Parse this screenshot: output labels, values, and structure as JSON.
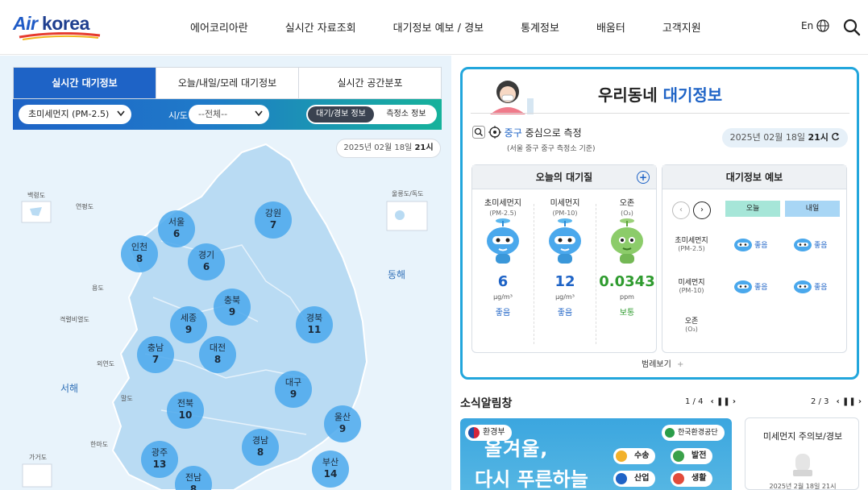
{
  "header": {
    "logo_air": "Air",
    "logo_korea": "korea",
    "nav": [
      "에어코리아란",
      "실시간 자료조회",
      "대기정보 예보 / 경보",
      "통계정보",
      "배움터",
      "고객지원"
    ],
    "lang": "En"
  },
  "left": {
    "tabs": [
      "실시간 대기정보",
      "오늘/내일/모레 대기정보",
      "실시간 공간분포"
    ],
    "pollutant_select": "초미세먼지 (PM-2.5)",
    "sido_label": "시/도",
    "sido_select": "--전체--",
    "toggle_on": "대기/경보 정보",
    "toggle_off": "측정소 정보",
    "date_prefix": "2025년 02월 18일",
    "date_hour": "21시",
    "places": {
      "baengnyeong": "백령도",
      "yeonpyeong": "연평도",
      "ulleung": "울릉도/독도",
      "gyeongnyeolbi": "격렬비열도",
      "oeyeon": "외연도",
      "eoyoung": "어청도",
      "malado": "말도",
      "hando": "한마도",
      "gageo": "가거도",
      "yongdo": "용도"
    },
    "seas": {
      "east": "동해",
      "west": "서해"
    },
    "regions": [
      {
        "name": "서울",
        "value": "6"
      },
      {
        "name": "인천",
        "value": "8"
      },
      {
        "name": "경기",
        "value": "6"
      },
      {
        "name": "강원",
        "value": "7"
      },
      {
        "name": "충북",
        "value": "9"
      },
      {
        "name": "세종",
        "value": "9"
      },
      {
        "name": "충남",
        "value": "7"
      },
      {
        "name": "대전",
        "value": "8"
      },
      {
        "name": "경북",
        "value": "11"
      },
      {
        "name": "대구",
        "value": "9"
      },
      {
        "name": "전북",
        "value": "10"
      },
      {
        "name": "울산",
        "value": "9"
      },
      {
        "name": "경남",
        "value": "8"
      },
      {
        "name": "광주",
        "value": "13"
      },
      {
        "name": "부산",
        "value": "14"
      },
      {
        "name": "전남",
        "value": "8"
      }
    ]
  },
  "neighborhood": {
    "title_a": "우리동네",
    "title_b": "대기정보",
    "location_gu": "중구",
    "location_rest": "중심으로 측정",
    "location_sub": "(서울 중구 중구 측정소 기준)",
    "date_prefix": "2025년 02월 18일",
    "date_hour": "21시",
    "today": {
      "title": "오늘의 대기질",
      "items": [
        {
          "name": "초미세먼지",
          "sub": "(PM-2.5)",
          "value": "6",
          "unit": "μg/m³",
          "grade": "좋음",
          "color": "#1e63c6"
        },
        {
          "name": "미세먼지",
          "sub": "(PM-10)",
          "value": "12",
          "unit": "μg/m³",
          "grade": "좋음",
          "color": "#1e63c6"
        },
        {
          "name": "오존",
          "sub": "(O₃)",
          "value": "0.0343",
          "unit": "ppm",
          "grade": "보통",
          "color": "#2f9b2f"
        }
      ]
    },
    "forecast": {
      "title": "대기정보 예보",
      "days": [
        "오늘",
        "내일"
      ],
      "rows": [
        {
          "name": "초미세먼지",
          "sub": "(PM-2.5)",
          "today": "좋음",
          "tomorrow": "좋음"
        },
        {
          "name": "미세먼지",
          "sub": "(PM-10)",
          "today": "좋음",
          "tomorrow": "좋음"
        },
        {
          "name": "오존",
          "sub": "(O₃)",
          "today": "",
          "tomorrow": ""
        }
      ]
    },
    "legend": "범례보기"
  },
  "news": {
    "title": "소식알림창",
    "pager": "1 / 4",
    "banner_line1": "올겨울,",
    "banner_line2": "다시 푸른하늘",
    "ministry": "환경부",
    "agency": "한국환경공단",
    "pills": [
      "수송",
      "발전",
      "산업",
      "생활"
    ]
  },
  "alert": {
    "pager": "2 / 3",
    "title": "미세먼지 주의보/경보",
    "date": "2025년 2월 18일 21시"
  }
}
